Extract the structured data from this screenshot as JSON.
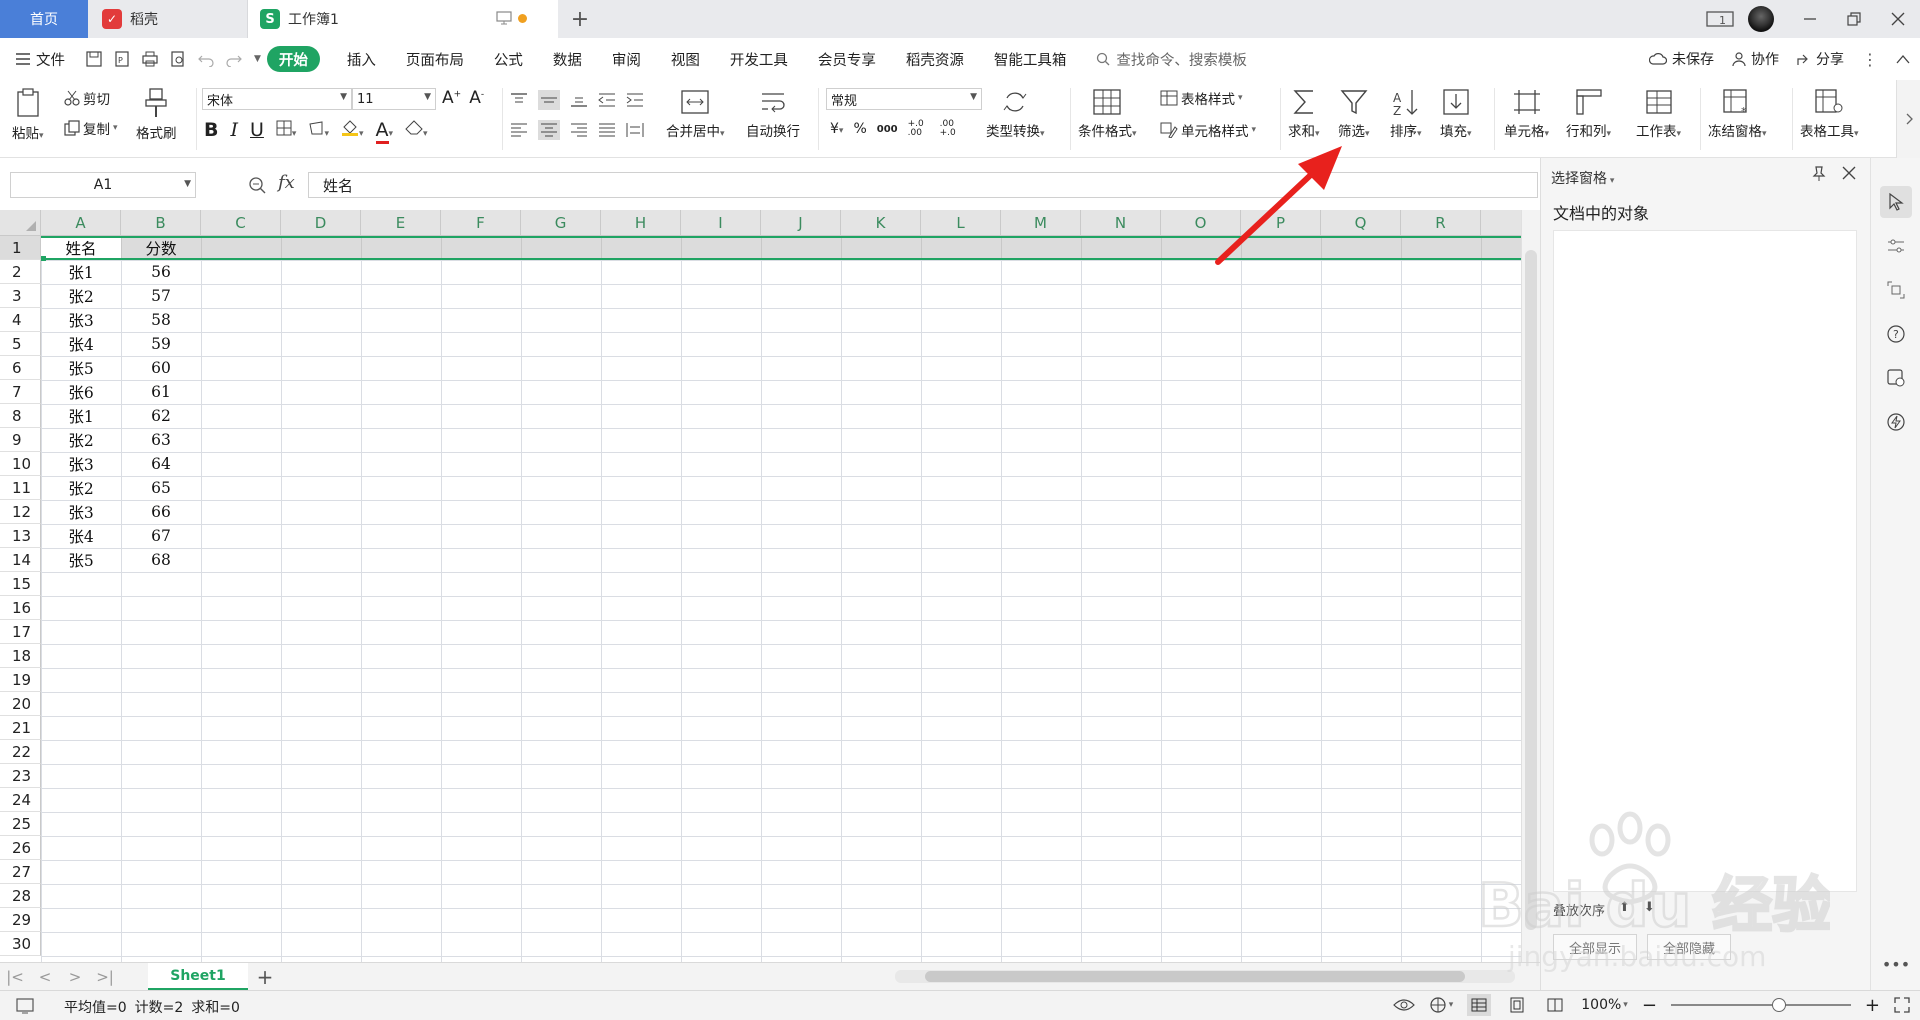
{
  "titlebar": {
    "tabs": [
      {
        "label": "首页"
      },
      {
        "label": "稻壳"
      },
      {
        "label": "工作簿1"
      }
    ],
    "new_tab": "+",
    "badge": "1"
  },
  "menubar": {
    "file": "文件",
    "items": [
      "开始",
      "插入",
      "页面布局",
      "公式",
      "数据",
      "审阅",
      "视图",
      "开发工具",
      "会员专享",
      "稻壳资源",
      "智能工具箱"
    ],
    "search_placeholder": "查找命令、搜索模板",
    "unsaved": "未保存",
    "collab": "协作",
    "share": "分享"
  },
  "ribbon": {
    "paste": "粘贴",
    "cut": "剪切",
    "copy": "复制",
    "format_painter": "格式刷",
    "font_name": "宋体",
    "font_size": "11",
    "merge_center": "合并居中",
    "wrap_text": "自动换行",
    "number_format": "常规",
    "type_convert": "类型转换",
    "cond_format": "条件格式",
    "table_style": "表格样式",
    "cell_style": "单元格样式",
    "sum": "求和",
    "filter": "筛选",
    "sort": "排序",
    "fill": "填充",
    "cell": "单元格",
    "rows_cols": "行和列",
    "worksheet": "工作表",
    "freeze": "冻结窗格",
    "table_tools": "表格工具",
    "currency": "¥",
    "percent": "%",
    "thousands": "000",
    "dec_inc": "+.0 .00",
    "dec_dec": ".00 +.0"
  },
  "formula": {
    "namebox": "A1",
    "fx": "fx",
    "content": "姓名"
  },
  "grid": {
    "columns": [
      "A",
      "B",
      "C",
      "D",
      "E",
      "F",
      "G",
      "H",
      "I",
      "J",
      "K",
      "L",
      "M",
      "N",
      "O",
      "P",
      "Q",
      "R"
    ],
    "row_count": 30,
    "header": [
      "姓名",
      "分数"
    ],
    "rows": [
      [
        "张1",
        "56"
      ],
      [
        "张2",
        "57"
      ],
      [
        "张3",
        "58"
      ],
      [
        "张4",
        "59"
      ],
      [
        "张5",
        "60"
      ],
      [
        "张6",
        "61"
      ],
      [
        "张1",
        "62"
      ],
      [
        "张2",
        "63"
      ],
      [
        "张3",
        "64"
      ],
      [
        "张2",
        "65"
      ],
      [
        "张3",
        "66"
      ],
      [
        "张4",
        "67"
      ],
      [
        "张5",
        "68"
      ]
    ]
  },
  "sheets": {
    "tabs": [
      "Sheet1"
    ],
    "add": "+"
  },
  "status": {
    "avg": "平均值=0",
    "count": "计数=2",
    "sum": "求和=0",
    "zoom": "100%",
    "zoom_fraction": 0.6
  },
  "sidepane": {
    "title": "选择窗格",
    "subtitle": "文档中的对象",
    "order_label": "叠放次序",
    "show_all": "全部显示",
    "hide_all": "全部隐藏"
  },
  "watermark": {
    "brand": "Bai du 经验",
    "url": "jingyan.baidu.com"
  },
  "colors": {
    "accent": "#1fa463",
    "home_tab": "#4a7fd8",
    "arrow": "#e8211d"
  }
}
